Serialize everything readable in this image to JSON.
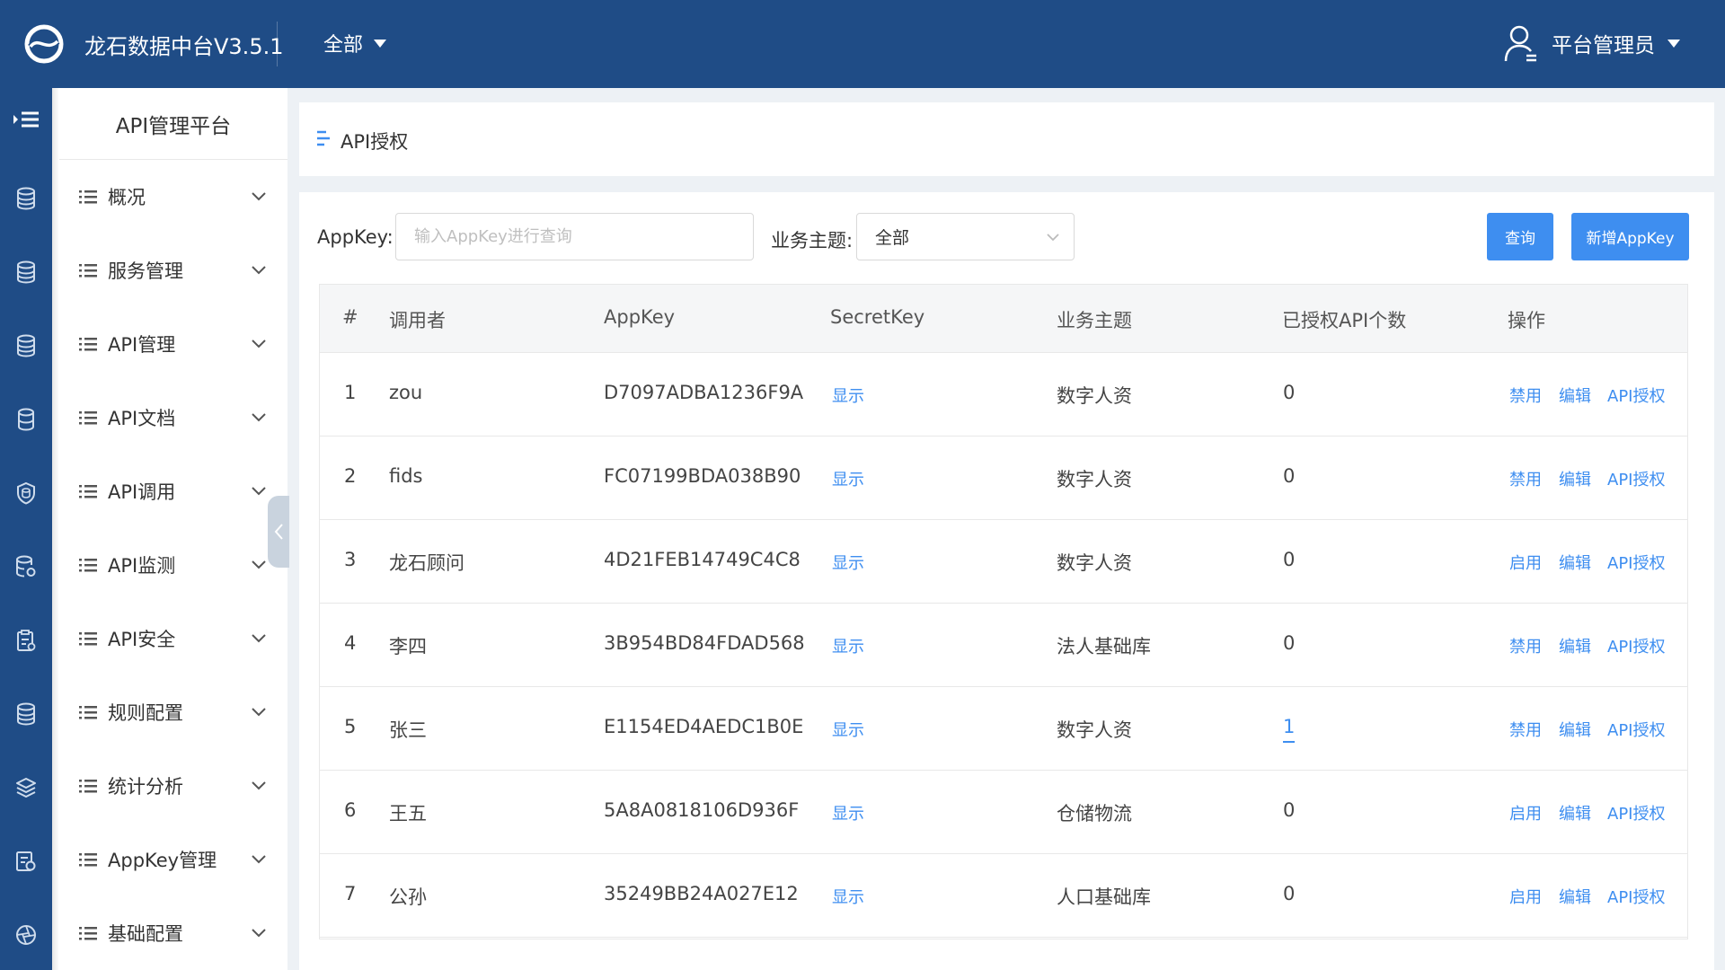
{
  "topbar": {
    "app_title": "龙石数据中台V3.5.1",
    "scope": "全部",
    "user_name": "平台管理员"
  },
  "sidebar": {
    "title": "API管理平台",
    "items": [
      {
        "label": "概况"
      },
      {
        "label": "服务管理"
      },
      {
        "label": "API管理"
      },
      {
        "label": "API文档"
      },
      {
        "label": "API调用"
      },
      {
        "label": "API监测"
      },
      {
        "label": "API安全"
      },
      {
        "label": "规则配置"
      },
      {
        "label": "统计分析"
      },
      {
        "label": "AppKey管理"
      },
      {
        "label": "基础配置"
      }
    ]
  },
  "page": {
    "title": "API授权"
  },
  "filters": {
    "appkey_label": "AppKey:",
    "appkey_placeholder": "输入AppKey进行查询",
    "topic_label": "业务主题:",
    "topic_value": "全部",
    "query_button": "查询",
    "add_button": "新增AppKey"
  },
  "table": {
    "columns": [
      "#",
      "调用者",
      "AppKey",
      "SecretKey",
      "业务主题",
      "已授权API个数",
      "操作"
    ],
    "rows": [
      {
        "index": "1",
        "caller": "zou",
        "appkey": "D7097ADBA1236F9A",
        "secret": "显示",
        "topic": "数字人资",
        "count": "0",
        "toggle": "禁用",
        "edit": "编辑",
        "auth": "API授权"
      },
      {
        "index": "2",
        "caller": "fids",
        "appkey": "FC07199BDA038B90",
        "secret": "显示",
        "topic": "数字人资",
        "count": "0",
        "toggle": "禁用",
        "edit": "编辑",
        "auth": "API授权"
      },
      {
        "index": "3",
        "caller": "龙石顾问",
        "appkey": "4D21FEB14749C4C8",
        "secret": "显示",
        "topic": "数字人资",
        "count": "0",
        "toggle": "启用",
        "edit": "编辑",
        "auth": "API授权"
      },
      {
        "index": "4",
        "caller": "李四",
        "appkey": "3B954BD84FDAD568",
        "secret": "显示",
        "topic": "法人基础库",
        "count": "0",
        "toggle": "禁用",
        "edit": "编辑",
        "auth": "API授权"
      },
      {
        "index": "5",
        "caller": "张三",
        "appkey": "E1154ED4AEDC1B0E",
        "secret": "显示",
        "topic": "数字人资",
        "count": "1",
        "toggle": "禁用",
        "edit": "编辑",
        "auth": "API授权"
      },
      {
        "index": "6",
        "caller": "王五",
        "appkey": "5A8A0818106D936F",
        "secret": "显示",
        "topic": "仓储物流",
        "count": "0",
        "toggle": "启用",
        "edit": "编辑",
        "auth": "API授权"
      },
      {
        "index": "7",
        "caller": "公孙",
        "appkey": "35249BB24A027E12",
        "secret": "显示",
        "topic": "人口基础库",
        "count": "0",
        "toggle": "启用",
        "edit": "编辑",
        "auth": "API授权"
      }
    ]
  },
  "colors": {
    "brand": "#1f4c86",
    "accent": "#3e8ef0",
    "page_bg": "#edf1f5"
  },
  "icons": {
    "rail": [
      "menu-toggle-icon",
      "database-icon",
      "database-icon",
      "database-icon",
      "database-icon",
      "shield-database-icon",
      "database-settings-icon",
      "clipboard-icon",
      "database-icon",
      "layers-icon",
      "report-icon",
      "aperture-icon"
    ]
  }
}
